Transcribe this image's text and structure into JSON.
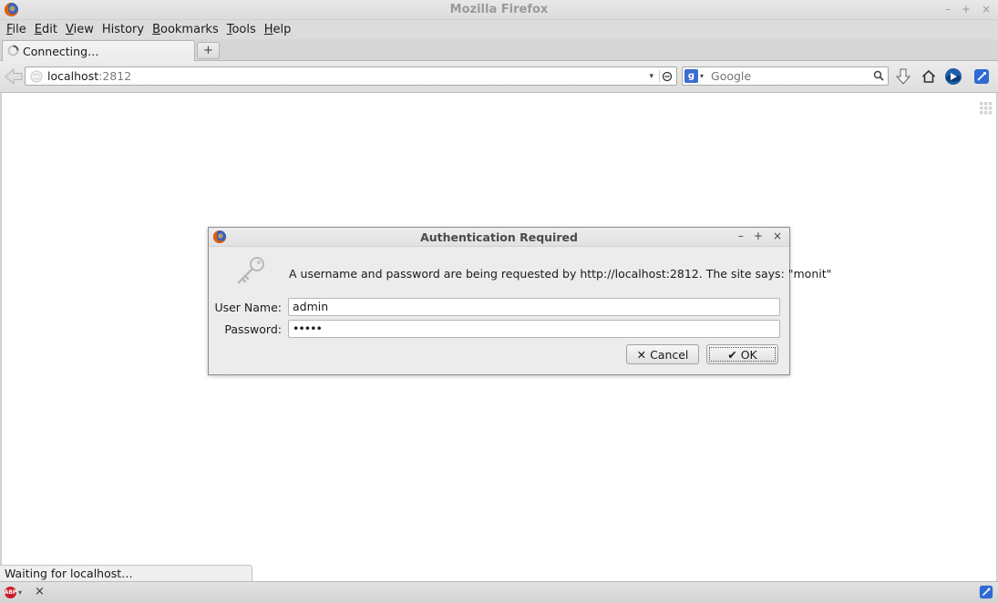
{
  "window": {
    "title": "Mozilla Firefox",
    "controls": [
      "–",
      "+",
      "×"
    ]
  },
  "menubar": {
    "items": [
      {
        "key": "F",
        "rest": "ile"
      },
      {
        "key": "E",
        "rest": "dit"
      },
      {
        "key": "V",
        "rest": "iew"
      },
      {
        "key": "",
        "rest": "History",
        "ul_index": 1
      },
      {
        "key": "B",
        "rest": "ookmarks"
      },
      {
        "key": "T",
        "rest": "ools"
      },
      {
        "key": "H",
        "rest": "elp"
      }
    ],
    "labels": [
      "File",
      "Edit",
      "View",
      "History",
      "Bookmarks",
      "Tools",
      "Help"
    ]
  },
  "tabs": {
    "active_label": "Connecting…",
    "new_tab_label": "+"
  },
  "navbar": {
    "url_host": "localhost",
    "url_port": ":2812",
    "url_dropdown": "▾",
    "search_engine_letter": "g",
    "search_placeholder": "Google"
  },
  "dialog": {
    "title": "Authentication Required",
    "controls": [
      "–",
      "+",
      "×"
    ],
    "message": "A username and password are being requested by http://localhost:2812. The site says: \"monit\"",
    "username_label": "User Name:",
    "username_value": "admin",
    "password_label": "Password:",
    "password_value": "•••••",
    "cancel_label": "Cancel",
    "ok_label": "OK"
  },
  "status": {
    "text": "Waiting for localhost…"
  },
  "addonbar": {
    "abp_badge": "ABP",
    "close_symbol": "×"
  },
  "colors": {
    "window_bg": "#d6d6d6",
    "content_bg": "#ffffff",
    "dialog_bg": "#ececec",
    "firefox_orange": "#e66000",
    "abp_red": "#c8202a",
    "link_blue": "#2e6ad3"
  },
  "icons": [
    "firefox-logo-icon",
    "loading-spinner-icon",
    "back-arrow-icon",
    "site-identity-icon",
    "reload-icon",
    "google-icon",
    "magnifier-icon",
    "download-icon",
    "home-icon",
    "xmarks-icon",
    "sync-icon",
    "grid-icon",
    "key-icon",
    "x-icon",
    "check-icon",
    "adblock-icon"
  ]
}
